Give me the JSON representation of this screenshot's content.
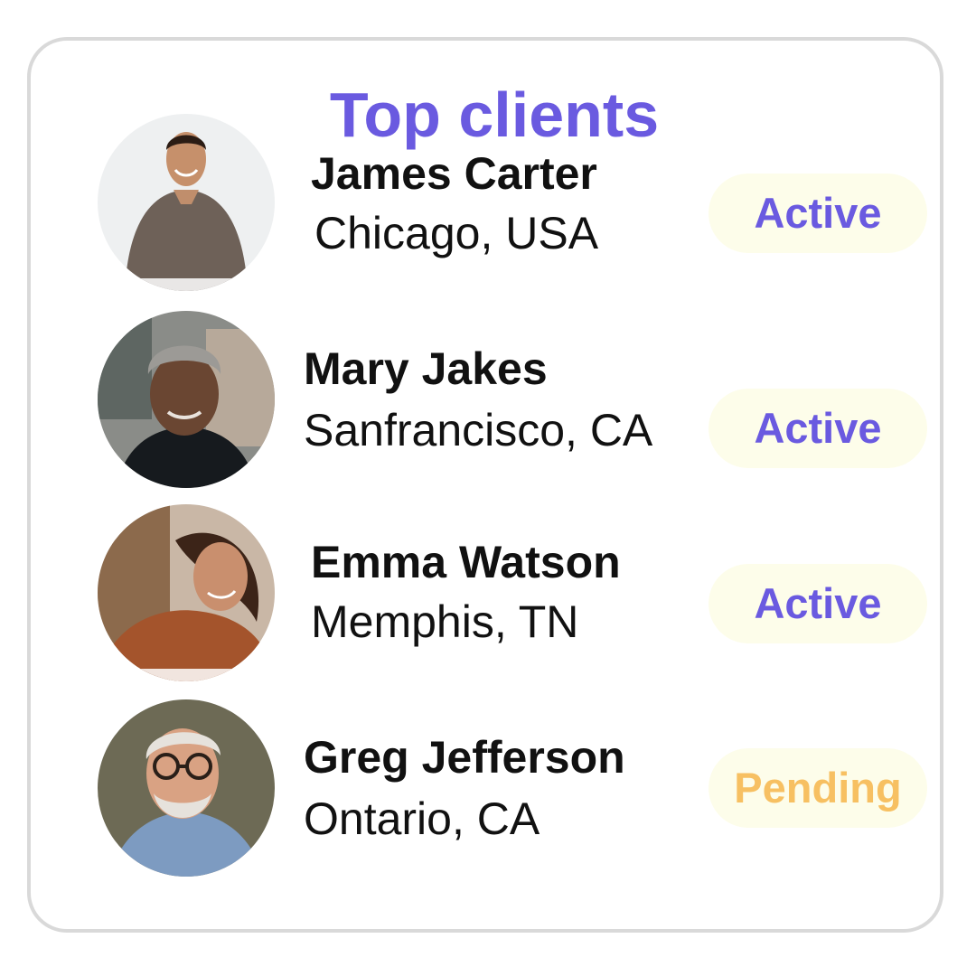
{
  "header": {
    "title": "Top clients",
    "title_color": "#6a5ae0"
  },
  "clients": [
    {
      "name": "James Carter",
      "location": "Chicago, USA",
      "status": "Active",
      "status_color": "#6a5ae0",
      "avatar_icon": "man-brown-sweater-photo"
    },
    {
      "name": "Mary Jakes",
      "location": "Sanfrancisco, CA",
      "status": "Active",
      "status_color": "#6a5ae0",
      "avatar_icon": "woman-grey-hair-photo"
    },
    {
      "name": "Emma Watson",
      "location": "Memphis, TN",
      "status": "Active",
      "status_color": "#6a5ae0",
      "avatar_icon": "woman-curly-hair-photo"
    },
    {
      "name": "Greg Jefferson",
      "location": "Ontario, CA",
      "status": "Pending",
      "status_color": "#f7c062",
      "avatar_icon": "older-man-glasses-photo"
    }
  ],
  "colors": {
    "pill_background": "#fdfdea",
    "card_border": "#d9d9d9"
  }
}
